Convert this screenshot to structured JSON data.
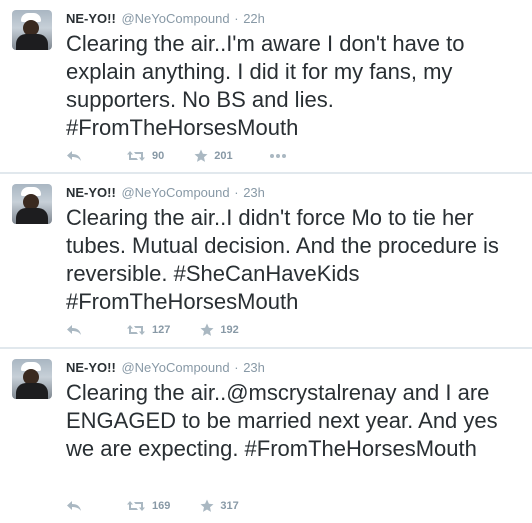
{
  "tweets": [
    {
      "name": "NE-YO!!",
      "handle": "@NeYoCompound",
      "separator": "·",
      "time": "22h",
      "text": "Clearing the air..I'm aware I don't have to explain anything. I did it for my fans, my supporters. No BS and lies. #FromTheHorsesMouth",
      "retweets": "90",
      "favorites": "201"
    },
    {
      "name": "NE-YO!!",
      "handle": "@NeYoCompound",
      "separator": "·",
      "time": "23h",
      "text": "Clearing the air..I didn't force Mo to tie her tubes. Mutual decision. And the procedure is reversible. #SheCanHaveKids #FromTheHorsesMouth",
      "retweets": "127",
      "favorites": "192"
    },
    {
      "name": "NE-YO!!",
      "handle": "@NeYoCompound",
      "separator": "·",
      "time": "23h",
      "text": "Clearing the air..@mscrystalrenay and I are ENGAGED to be married next year. And yes we are expecting. #FromTheHorsesMouth",
      "retweets": "169",
      "favorites": "317"
    }
  ],
  "icons": {
    "reply": "reply-icon",
    "retweet": "retweet-icon",
    "favorite": "star-icon",
    "more": "more-icon"
  },
  "colors": {
    "text": "#292f33",
    "muted": "#8899a6",
    "divider": "#e1e8ed",
    "icon": "#aab8c2"
  }
}
